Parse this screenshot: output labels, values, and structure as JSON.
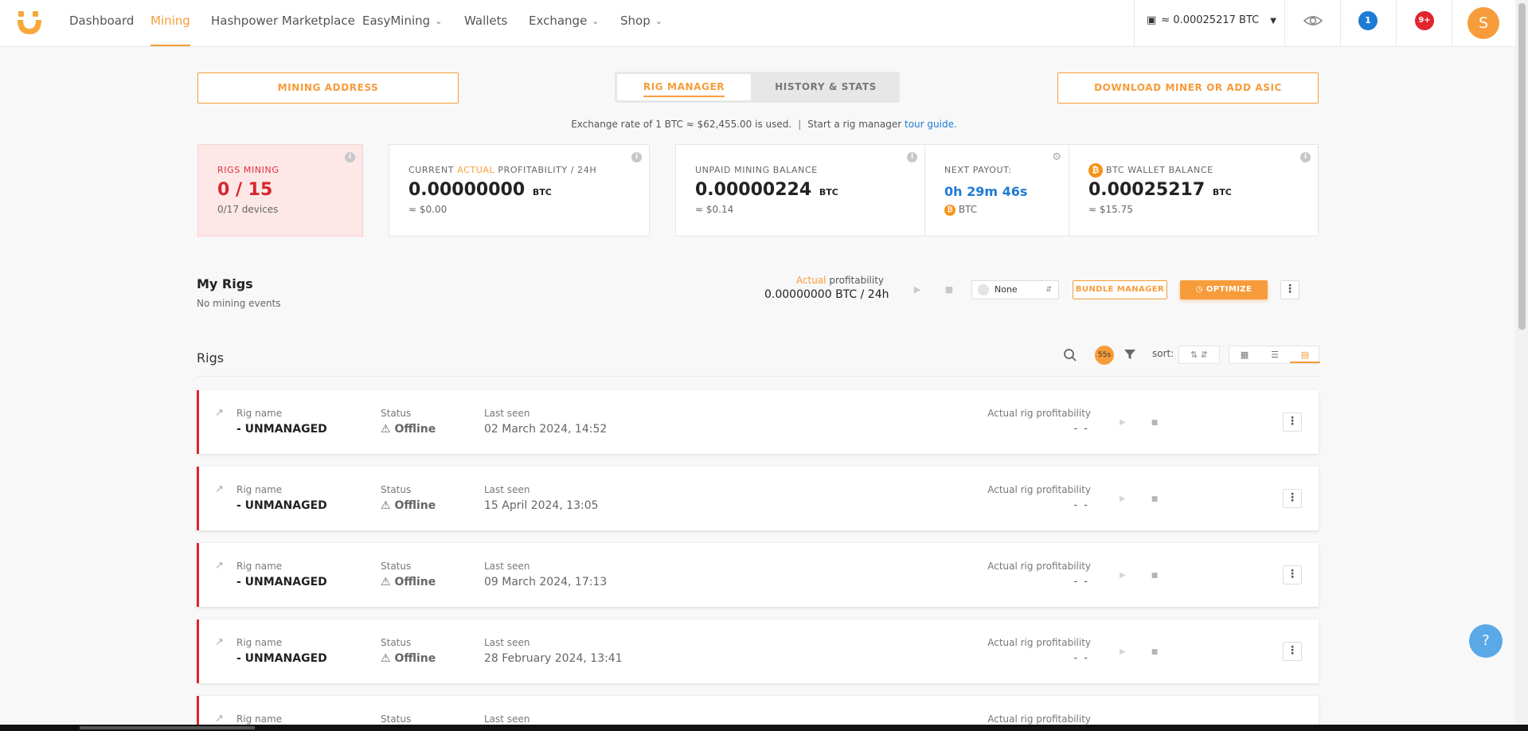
{
  "nav": {
    "links": [
      {
        "label": "Dashboard"
      },
      {
        "label": "Mining"
      },
      {
        "label": "Hashpower Marketplace"
      },
      {
        "label": "EasyMining"
      },
      {
        "label": "Wallets"
      },
      {
        "label": "Exchange"
      },
      {
        "label": "Shop"
      }
    ],
    "wallet_balance": "≈ 0.00025217 BTC",
    "notifications_count": "1",
    "alerts_count": "9+",
    "avatar_initial": "S"
  },
  "top": {
    "mining_address_btn": "MINING ADDRESS",
    "tab_rig_manager": "RIG MANAGER",
    "tab_history": "HISTORY & STATS",
    "download_btn": "DOWNLOAD MINER OR ADD ASIC",
    "rate_text": "Exchange rate of 1 BTC ≈ $62,455.00 is used.",
    "guide_prefix": "Start a rig manager",
    "guide_link": "tour guide."
  },
  "stats": {
    "rigs_label": "RIGS MINING",
    "rigs_value": "0 / 15",
    "rigs_sub": "0/17 devices",
    "profit_label_pre": "CURRENT",
    "profit_label_mid": "ACTUAL",
    "profit_label_post": "PROFITABILITY / 24H",
    "profit_value": "0.00000000",
    "profit_unit": "BTC",
    "profit_sub": "≈ $0.00",
    "unpaid_label": "UNPAID MINING BALANCE",
    "unpaid_value": "0.00000224",
    "unpaid_unit": "BTC",
    "unpaid_sub": "≈ $0.14",
    "payout_label": "NEXT PAYOUT:",
    "payout_value": "0h 29m 46s",
    "payout_sub": "BTC",
    "wallet_label": "BTC WALLET BALANCE",
    "wallet_value": "0.00025217",
    "wallet_unit": "BTC",
    "wallet_sub": "≈ $15.75"
  },
  "myrigs": {
    "title": "My Rigs",
    "subtitle": "No mining events",
    "profit_word_orange": "Actual",
    "profit_word": "profitability",
    "profit_value": "0.00000000 BTC / 24h",
    "select_value": "None",
    "bundle_btn": "BUNDLE MANAGER",
    "optimize_btn": "OPTIMIZE"
  },
  "rigs": {
    "title": "Rigs",
    "timer": "55s",
    "sort_label": "sort:",
    "labels": {
      "name": "Rig name",
      "status": "Status",
      "last_seen": "Last seen",
      "profit": "Actual rig profitability"
    },
    "rows": [
      {
        "name": "- UNMANAGED",
        "status": "Offline",
        "last_seen": "02 March 2024, 14:52",
        "profit": "- -"
      },
      {
        "name": "- UNMANAGED",
        "status": "Offline",
        "last_seen": "15 April 2024, 13:05",
        "profit": "- -"
      },
      {
        "name": "- UNMANAGED",
        "status": "Offline",
        "last_seen": "09 March 2024, 17:13",
        "profit": "- -"
      },
      {
        "name": "- UNMANAGED",
        "status": "Offline",
        "last_seen": "28 February 2024, 13:41",
        "profit": "- -"
      },
      {
        "name": "",
        "status": "",
        "last_seen": "",
        "profit": ""
      }
    ]
  },
  "help_label": "?",
  "colors": {
    "accent": "#f79c3b",
    "danger": "#e0252f",
    "link": "#1d7bd6",
    "bitcoin": "#f7931a"
  }
}
